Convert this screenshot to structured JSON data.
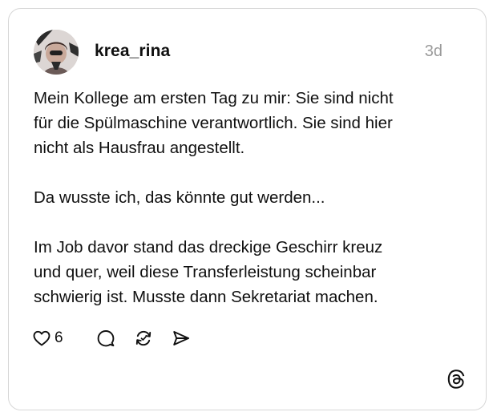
{
  "post": {
    "username": "krea_rina",
    "timestamp": "3d",
    "paragraphs": [
      {
        "lines": [
          "Mein Kollege am ersten Tag zu mir: Sie sind nicht",
          "für die Spülmaschine verantwortlich. Sie sind hier",
          "nicht als Hausfrau angestellt."
        ]
      },
      {
        "lines": [
          "Da wusste ich, das könnte gut werden..."
        ]
      },
      {
        "lines": [
          "Im Job davor stand das dreckige Geschirr kreuz",
          "und quer, weil diese Transferleistung scheinbar",
          "schwierig ist. Musste dann Sekretariat machen."
        ]
      }
    ]
  },
  "actions": {
    "like_count": "6",
    "icons": [
      "heart-icon",
      "comment-icon",
      "repost-icon",
      "share-icon"
    ]
  },
  "branding": {
    "logo": "threads-logo-icon"
  },
  "colors": {
    "text": "#101010",
    "muted": "#9a9a9a",
    "border": "#d6d6d6"
  }
}
